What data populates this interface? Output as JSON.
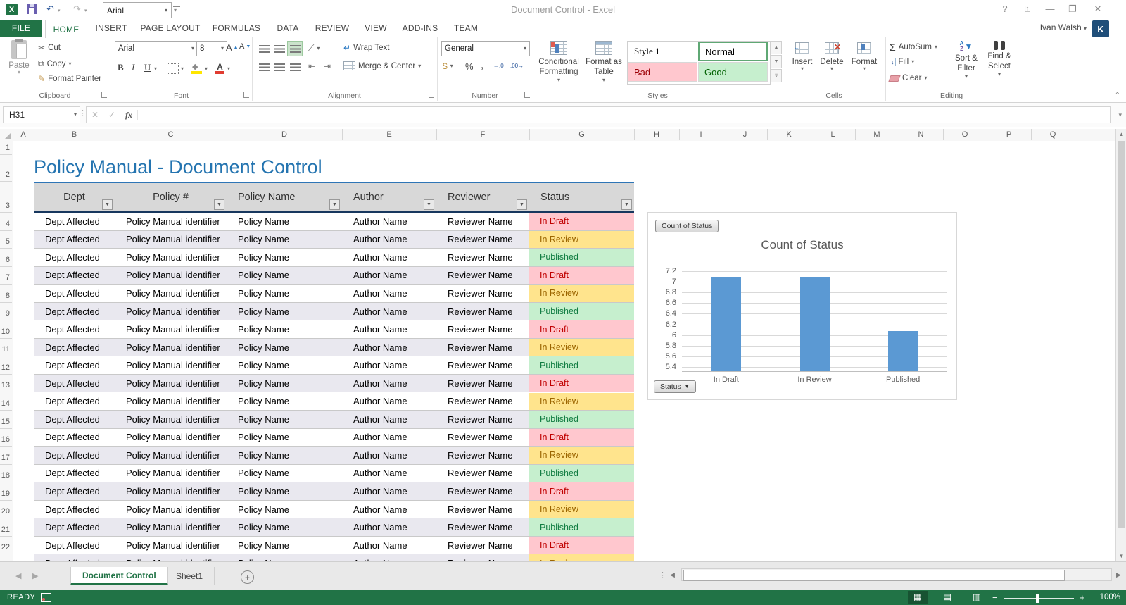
{
  "titlebar": {
    "title": "Document Control - Excel",
    "qat_font": "Arial",
    "help": "?",
    "minimize": "—",
    "close": "✕"
  },
  "account": {
    "user": "Ivan Walsh",
    "avatar": "K"
  },
  "ribbon_tabs": [
    {
      "label": "FILE",
      "file": true
    },
    {
      "label": "HOME",
      "active": true
    },
    {
      "label": "INSERT"
    },
    {
      "label": "PAGE LAYOUT"
    },
    {
      "label": "FORMULAS"
    },
    {
      "label": "DATA"
    },
    {
      "label": "REVIEW"
    },
    {
      "label": "VIEW"
    },
    {
      "label": "ADD-INS"
    },
    {
      "label": "TEAM"
    }
  ],
  "ribbon": {
    "clipboard": {
      "group": "Clipboard",
      "paste": "Paste",
      "cut": "Cut",
      "copy": "Copy",
      "format_painter": "Format Painter"
    },
    "font": {
      "group": "Font",
      "name": "Arial",
      "size": "8",
      "bold": "B",
      "italic": "I",
      "underline": "U",
      "color_letter": "A"
    },
    "alignment": {
      "group": "Alignment",
      "wrap_text": "Wrap Text",
      "merge_center": "Merge & Center"
    },
    "number": {
      "group": "Number",
      "format": "General",
      "currency": "$",
      "percent": "%",
      "comma": ",",
      "inc_dec": "←.0",
      "dec_dec": ".00→"
    },
    "styles": {
      "group": "Styles",
      "conditional": "Conditional Formatting",
      "format_table": "Format as Table",
      "gallery": [
        "Style 1",
        "Normal",
        "Bad",
        "Good"
      ]
    },
    "cells": {
      "group": "Cells",
      "insert": "Insert",
      "delete": "Delete",
      "format": "Format"
    },
    "editing": {
      "group": "Editing",
      "autosum": "AutoSum",
      "fill": "Fill",
      "clear": "Clear",
      "sort": "Sort & Filter",
      "find": "Find & Select",
      "sigma": "Σ"
    }
  },
  "formula_bar": {
    "name_box": "H31",
    "cancel": "✕",
    "enter": "✓",
    "fx": "fx",
    "value": ""
  },
  "sheet": {
    "title": "Policy Manual - Document Control",
    "col_letters": [
      "A",
      "B",
      "C",
      "D",
      "E",
      "F",
      "G",
      "H",
      "I",
      "J",
      "K",
      "L",
      "M",
      "N",
      "O",
      "P",
      "Q"
    ],
    "row_numbers": [
      "1",
      "2",
      "3",
      "4",
      "5",
      "6",
      "7",
      "8",
      "9",
      "10",
      "11",
      "12",
      "13",
      "14",
      "15",
      "16",
      "17",
      "18",
      "19",
      "20",
      "21",
      "22"
    ],
    "table": {
      "headers": [
        "Dept",
        "Policy #",
        "Policy Name",
        "Author",
        "Reviewer",
        "Status"
      ],
      "rows": [
        {
          "dept": "Dept Affected",
          "policy_num": "Policy Manual identifier",
          "policy_name": "Policy Name",
          "author": "Author Name",
          "reviewer": "Reviewer Name",
          "status": "In Draft"
        },
        {
          "dept": "Dept Affected",
          "policy_num": "Policy Manual identifier",
          "policy_name": "Policy Name",
          "author": "Author Name",
          "reviewer": "Reviewer Name",
          "status": "In Review"
        },
        {
          "dept": "Dept Affected",
          "policy_num": "Policy Manual identifier",
          "policy_name": "Policy Name",
          "author": "Author Name",
          "reviewer": "Reviewer Name",
          "status": "Published"
        },
        {
          "dept": "Dept Affected",
          "policy_num": "Policy Manual identifier",
          "policy_name": "Policy Name",
          "author": "Author Name",
          "reviewer": "Reviewer Name",
          "status": "In Draft"
        },
        {
          "dept": "Dept Affected",
          "policy_num": "Policy Manual identifier",
          "policy_name": "Policy Name",
          "author": "Author Name",
          "reviewer": "Reviewer Name",
          "status": "In Review"
        },
        {
          "dept": "Dept Affected",
          "policy_num": "Policy Manual identifier",
          "policy_name": "Policy Name",
          "author": "Author Name",
          "reviewer": "Reviewer Name",
          "status": "Published"
        },
        {
          "dept": "Dept Affected",
          "policy_num": "Policy Manual identifier",
          "policy_name": "Policy Name",
          "author": "Author Name",
          "reviewer": "Reviewer Name",
          "status": "In Draft"
        },
        {
          "dept": "Dept Affected",
          "policy_num": "Policy Manual identifier",
          "policy_name": "Policy Name",
          "author": "Author Name",
          "reviewer": "Reviewer Name",
          "status": "In Review"
        },
        {
          "dept": "Dept Affected",
          "policy_num": "Policy Manual identifier",
          "policy_name": "Policy Name",
          "author": "Author Name",
          "reviewer": "Reviewer Name",
          "status": "Published"
        },
        {
          "dept": "Dept Affected",
          "policy_num": "Policy Manual identifier",
          "policy_name": "Policy Name",
          "author": "Author Name",
          "reviewer": "Reviewer Name",
          "status": "In Draft"
        },
        {
          "dept": "Dept Affected",
          "policy_num": "Policy Manual identifier",
          "policy_name": "Policy Name",
          "author": "Author Name",
          "reviewer": "Reviewer Name",
          "status": "In Review"
        },
        {
          "dept": "Dept Affected",
          "policy_num": "Policy Manual identifier",
          "policy_name": "Policy Name",
          "author": "Author Name",
          "reviewer": "Reviewer Name",
          "status": "Published"
        },
        {
          "dept": "Dept Affected",
          "policy_num": "Policy Manual identifier",
          "policy_name": "Policy Name",
          "author": "Author Name",
          "reviewer": "Reviewer Name",
          "status": "In Draft"
        },
        {
          "dept": "Dept Affected",
          "policy_num": "Policy Manual identifier",
          "policy_name": "Policy Name",
          "author": "Author Name",
          "reviewer": "Reviewer Name",
          "status": "In Review"
        },
        {
          "dept": "Dept Affected",
          "policy_num": "Policy Manual identifier",
          "policy_name": "Policy Name",
          "author": "Author Name",
          "reviewer": "Reviewer Name",
          "status": "Published"
        },
        {
          "dept": "Dept Affected",
          "policy_num": "Policy Manual identifier",
          "policy_name": "Policy Name",
          "author": "Author Name",
          "reviewer": "Reviewer Name",
          "status": "In Draft"
        },
        {
          "dept": "Dept Affected",
          "policy_num": "Policy Manual identifier",
          "policy_name": "Policy Name",
          "author": "Author Name",
          "reviewer": "Reviewer Name",
          "status": "In Review"
        },
        {
          "dept": "Dept Affected",
          "policy_num": "Policy Manual identifier",
          "policy_name": "Policy Name",
          "author": "Author Name",
          "reviewer": "Reviewer Name",
          "status": "Published"
        },
        {
          "dept": "Dept Affected",
          "policy_num": "Policy Manual identifier",
          "policy_name": "Policy Name",
          "author": "Author Name",
          "reviewer": "Reviewer Name",
          "status": "In Draft"
        },
        {
          "dept": "Dept Affected",
          "policy_num": "Policy Manual identifier",
          "policy_name": "Policy Name",
          "author": "Author Name",
          "reviewer": "Reviewer Name",
          "status": "In Review"
        }
      ]
    },
    "status_styles": {
      "In Draft": {
        "bg": "#ffc7ce",
        "fg": "#c00000"
      },
      "In Review": {
        "bg": "#ffe48d",
        "fg": "#9c6500"
      },
      "Published": {
        "bg": "#c6efce",
        "fg": "#107c41"
      }
    }
  },
  "chart_data": {
    "type": "bar",
    "title": "Count of Status",
    "field_button": "Count of Status",
    "axis_field_button": "Status",
    "categories": [
      "In Draft",
      "In Review",
      "Published"
    ],
    "values": [
      7,
      7,
      6
    ],
    "y_ticks": [
      5.4,
      5.6,
      5.8,
      6,
      6.2,
      6.4,
      6.6,
      6.8,
      7,
      7.2
    ],
    "ylim": [
      5.32,
      7.2
    ],
    "bar_color": "#5b99d3",
    "grid": true,
    "legend": "none",
    "xlabel": "",
    "ylabel": ""
  },
  "sheet_tabs": [
    {
      "label": "Document Control",
      "active": true
    },
    {
      "label": "Sheet1",
      "active": false
    }
  ],
  "status_bar": {
    "mode": "READY",
    "zoom": "100%",
    "zoom_minus": "−",
    "zoom_plus": "+"
  }
}
